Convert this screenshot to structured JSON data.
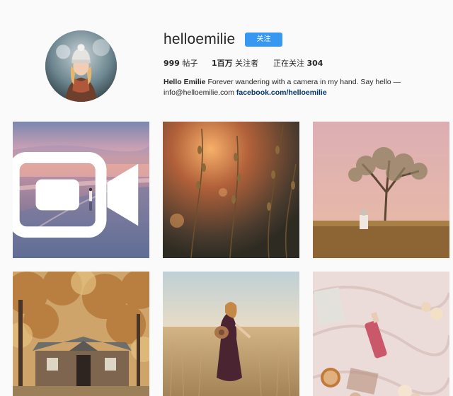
{
  "profile": {
    "username": "helloemilie",
    "follow_label": "关注",
    "stats": {
      "posts_count": "999",
      "posts_label": " 帖子",
      "followers_count": "1百万",
      "followers_label": " 关注者",
      "following_label": "正在关注 ",
      "following_count": "304"
    },
    "bio": {
      "name": "Hello Emilie",
      "text": " Forever wandering with a camera in my hand. Say hello — info@helloemilie.com ",
      "link": "facebook.com/helloemilie"
    }
  },
  "colors": {
    "follow_button": "#3897f0",
    "link": "#003569",
    "background": "#fafafa"
  },
  "posts": [
    {
      "subject": "beach-at-sunset",
      "has_video": true,
      "icon": "video-icon"
    },
    {
      "subject": "dried-flowers-backlit",
      "has_video": false
    },
    {
      "subject": "lone-tree-field",
      "has_video": false
    },
    {
      "subject": "autumn-cabin",
      "has_video": false
    },
    {
      "subject": "wheat-field-woman",
      "has_video": false
    },
    {
      "subject": "flatlay-blanket",
      "has_video": false
    }
  ]
}
